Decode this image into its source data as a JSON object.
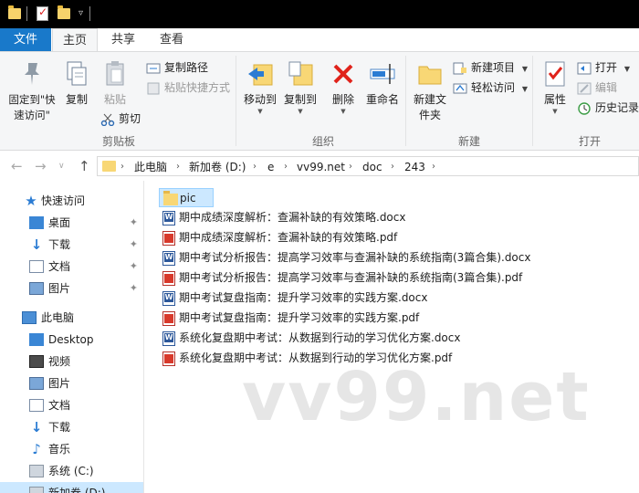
{
  "tabs": {
    "file": "文件",
    "home": "主页",
    "share": "共享",
    "view": "查看"
  },
  "ribbon": {
    "clipboard": {
      "pin": "固定到\"快速访问\"",
      "copy": "复制",
      "paste": "粘贴",
      "copy_path": "复制路径",
      "paste_shortcut": "粘贴快捷方式",
      "cut": "剪切",
      "group": "剪贴板"
    },
    "organize": {
      "move_to": "移动到",
      "copy_to": "复制到",
      "delete": "删除",
      "rename": "重命名",
      "group": "组织"
    },
    "new": {
      "new_folder": "新建文件夹",
      "new_item": "新建项目",
      "easy_access": "轻松访问",
      "group": "新建"
    },
    "open": {
      "properties": "属性",
      "open": "打开",
      "edit": "编辑",
      "history": "历史记录",
      "group": "打开"
    }
  },
  "address": {
    "crumbs": [
      "此电脑",
      "新加卷 (D:)",
      "e",
      "vv99.net",
      "doc",
      "243"
    ]
  },
  "nav": {
    "quick_access": "快速访问",
    "quick": [
      {
        "label": "桌面",
        "icon": "desktop-icon"
      },
      {
        "label": "下载",
        "icon": "download-icon"
      },
      {
        "label": "文档",
        "icon": "documents-icon"
      },
      {
        "label": "图片",
        "icon": "pictures-icon"
      }
    ],
    "this_pc": "此电脑",
    "pc": [
      {
        "label": "Desktop",
        "icon": "desktop-icon"
      },
      {
        "label": "视频",
        "icon": "video-icon"
      },
      {
        "label": "图片",
        "icon": "pictures-icon"
      },
      {
        "label": "文档",
        "icon": "documents-icon"
      },
      {
        "label": "下载",
        "icon": "download-icon"
      },
      {
        "label": "音乐",
        "icon": "music-icon"
      },
      {
        "label": "系统 (C:)",
        "icon": "drive-icon"
      },
      {
        "label": "新加卷 (D:)",
        "icon": "drive-icon"
      }
    ]
  },
  "files": [
    {
      "name": "pic",
      "type": "folder"
    },
    {
      "name": "期中成绩深度解析：查漏补缺的有效策略.docx",
      "type": "docx"
    },
    {
      "name": "期中成绩深度解析：查漏补缺的有效策略.pdf",
      "type": "pdf"
    },
    {
      "name": "期中考试分析报告：提高学习效率与查漏补缺的系统指南(3篇合集).docx",
      "type": "docx"
    },
    {
      "name": "期中考试分析报告：提高学习效率与查漏补缺的系统指南(3篇合集).pdf",
      "type": "pdf"
    },
    {
      "name": "期中考试复盘指南：提升学习效率的实践方案.docx",
      "type": "docx"
    },
    {
      "name": "期中考试复盘指南：提升学习效率的实践方案.pdf",
      "type": "pdf"
    },
    {
      "name": "系统化复盘期中考试：从数据到行动的学习优化方案.docx",
      "type": "docx"
    },
    {
      "name": "系统化复盘期中考试：从数据到行动的学习优化方案.pdf",
      "type": "pdf"
    }
  ],
  "watermark": "vv99.net",
  "colors": {
    "accent": "#1979ca",
    "selection": "#cce8ff",
    "folder": "#f8d775"
  }
}
